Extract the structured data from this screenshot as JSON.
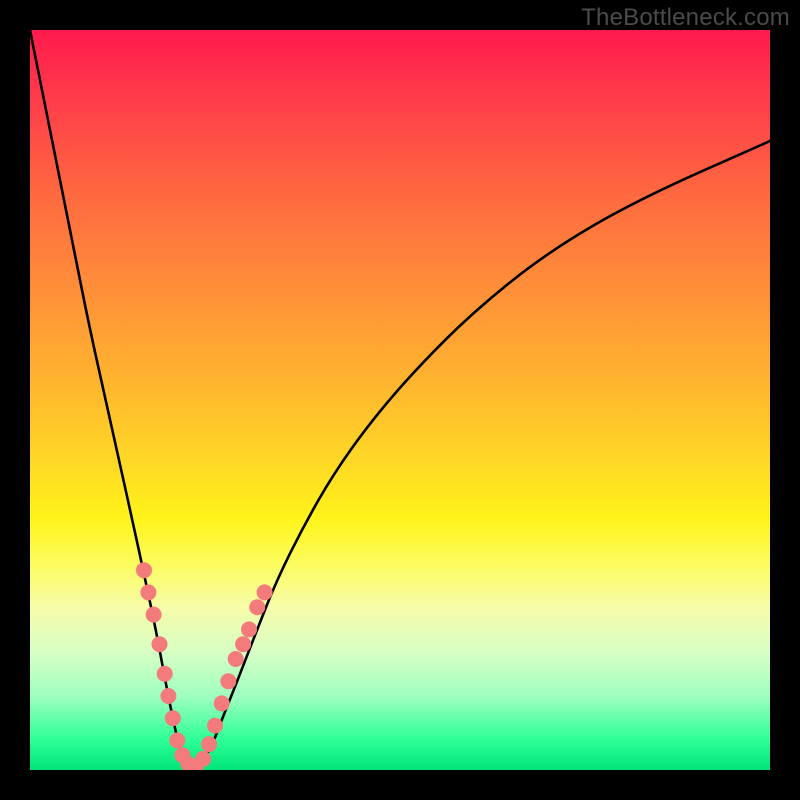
{
  "watermark": "TheBottleneck.com",
  "colors": {
    "frame": "#000000",
    "curve": "#000000",
    "marker_fill": "#f47b7b",
    "marker_stroke": "#d45a5a",
    "gradient_top": "#ff1a4d",
    "gradient_bottom": "#00e47a"
  },
  "chart_data": {
    "type": "line",
    "title": "",
    "xlabel": "",
    "ylabel": "",
    "xlim": [
      0,
      100
    ],
    "ylim": [
      0,
      100
    ],
    "grid": false,
    "legend": false,
    "note": "Axes are unlabeled; x≈component capability, y≈bottleneck %. Values estimated from pixel positions.",
    "series": [
      {
        "name": "bottleneck-curve",
        "x": [
          0,
          2,
          4,
          6,
          8,
          10,
          12,
          14,
          15.5,
          17,
          18.3,
          19.3,
          20.2,
          21,
          22,
          23,
          24.5,
          26,
          28,
          30.7,
          33.5,
          37,
          41,
          46,
          52,
          60,
          70,
          82,
          100
        ],
        "y": [
          100,
          90,
          80,
          70,
          60,
          51,
          42,
          33,
          26,
          19,
          12,
          7,
          3,
          1,
          0.5,
          1,
          3,
          7,
          12,
          19,
          26,
          33,
          40,
          47,
          54,
          62,
          70,
          77,
          85
        ]
      }
    ],
    "markers": {
      "name": "highlight-points",
      "x": [
        15.4,
        16.0,
        16.7,
        17.5,
        18.2,
        18.7,
        19.3,
        19.9,
        20.6,
        21.4,
        22.4,
        23.4,
        24.2,
        25.0,
        25.9,
        26.8,
        27.8,
        28.8,
        29.6,
        30.7,
        31.7
      ],
      "y": [
        27,
        24,
        21,
        17,
        13,
        10,
        7,
        4,
        2,
        0.8,
        0.5,
        1.5,
        3.5,
        6,
        9,
        12,
        15,
        17,
        19,
        22,
        24
      ]
    }
  }
}
